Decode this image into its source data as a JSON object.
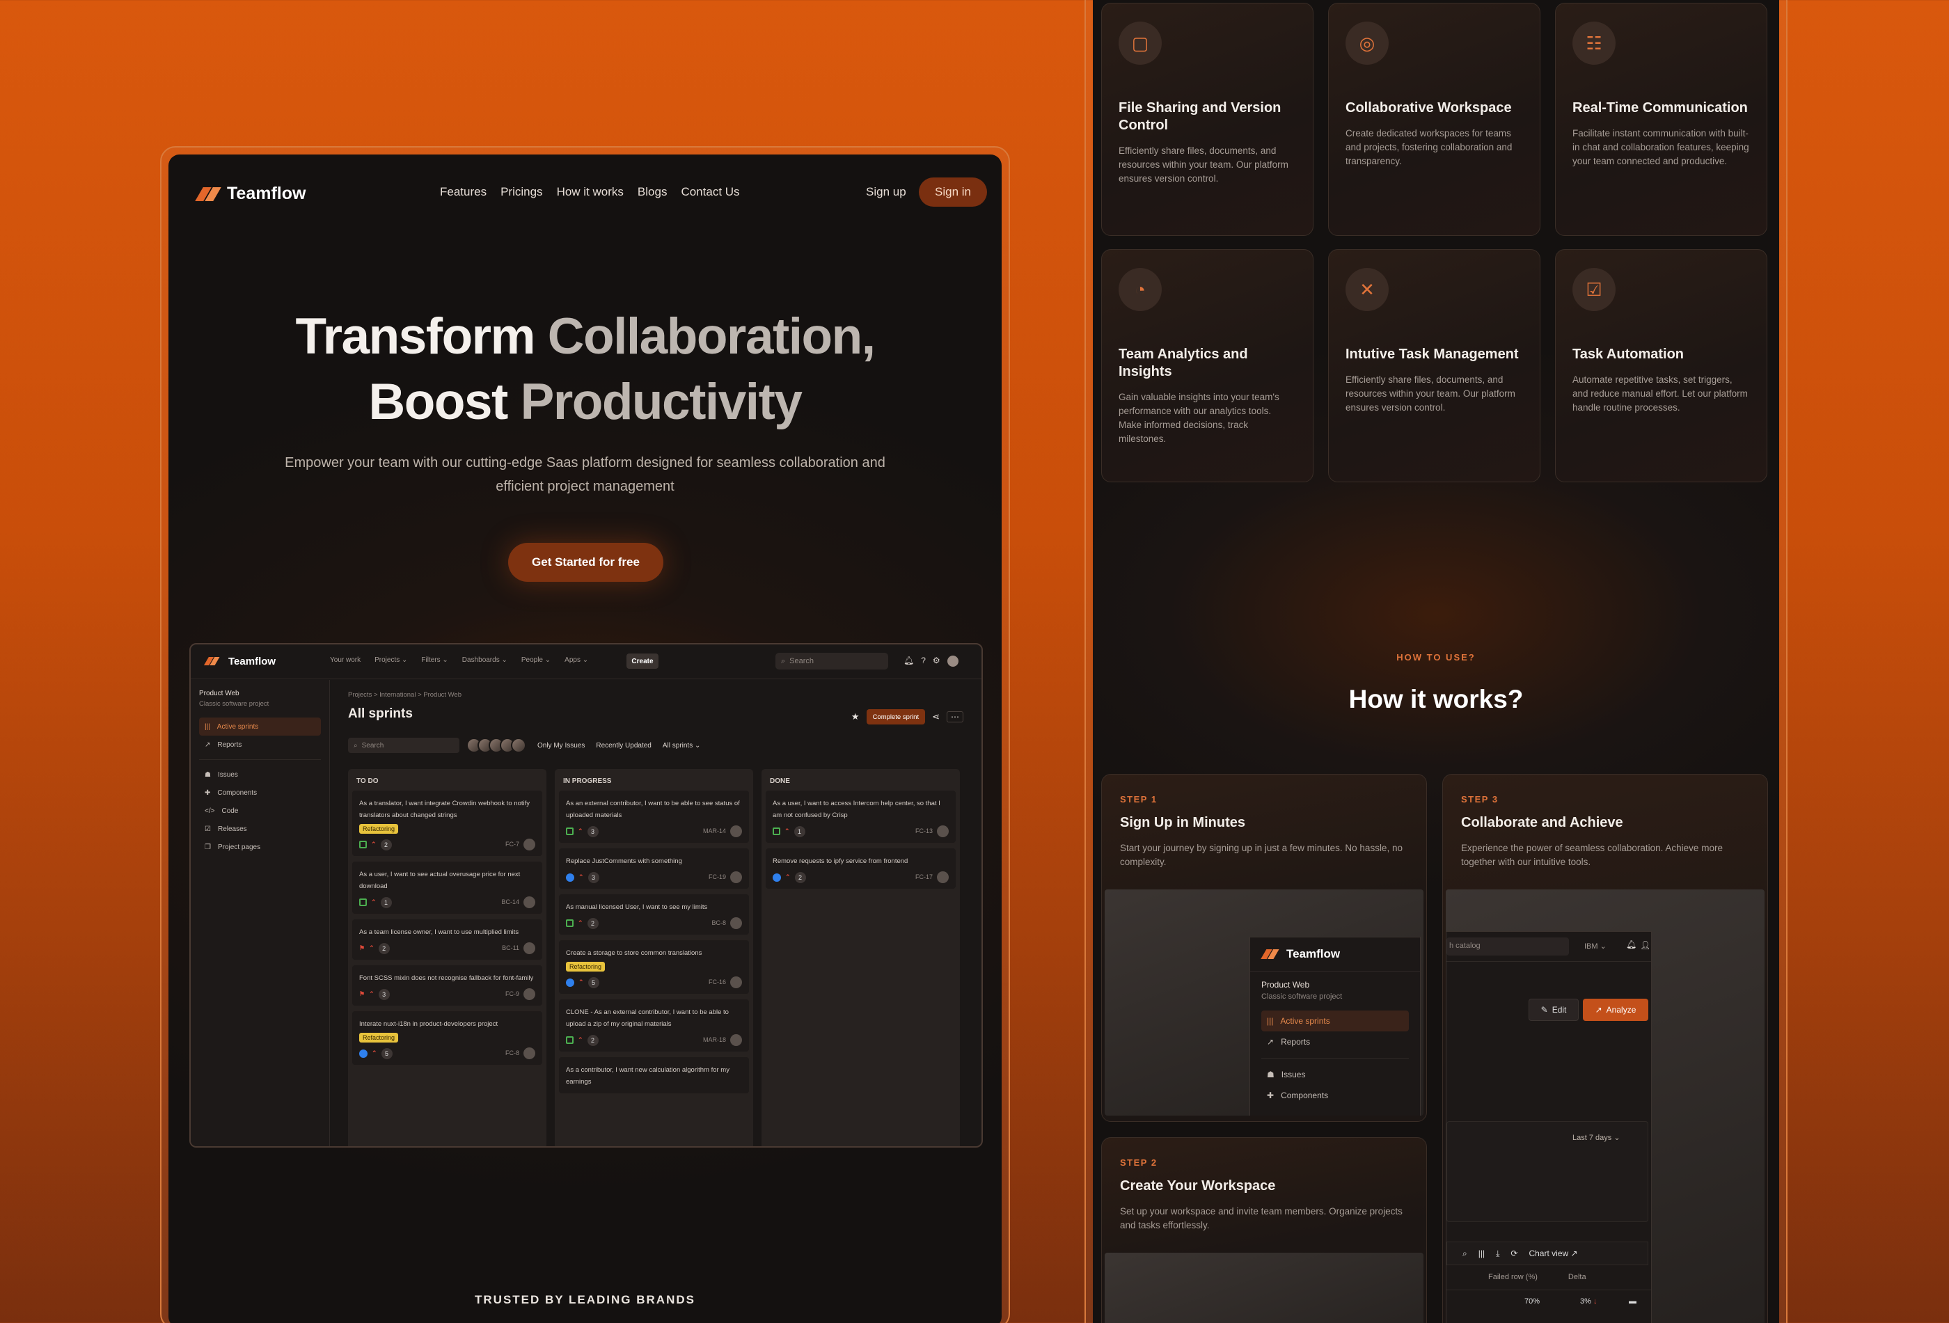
{
  "landing": {
    "brand": "Teamflow",
    "nav": [
      "Features",
      "Pricings",
      "How it works",
      "Blogs",
      "Contact Us"
    ],
    "signup": "Sign up",
    "signin": "Sign in",
    "hero_line1_a": "Transform",
    "hero_line1_b": "Collaboration,",
    "hero_line2_a": "Boost",
    "hero_line2_b": "Productivity",
    "hero_sub": "Empower your team with our cutting-edge Saas platform designed for seamless collaboration and efficient project management",
    "cta": "Get Started for free",
    "trusted": "TRUSTED BY LEADING BRANDS"
  },
  "app": {
    "brand": "Teamflow",
    "menu": [
      "Your work",
      "Projects ⌄",
      "Filters ⌄",
      "Dashboards ⌄",
      "People ⌄",
      "Apps ⌄"
    ],
    "create": "Create",
    "search": "Search",
    "project_name": "Product Web",
    "project_type": "Classic software project",
    "side_items": [
      {
        "label": "Active sprints",
        "active": true
      },
      {
        "label": "Reports"
      },
      {
        "label": "Issues"
      },
      {
        "label": "Components"
      },
      {
        "label": "Code"
      },
      {
        "label": "Releases"
      },
      {
        "label": "Project pages"
      }
    ],
    "crumb": "Projects  >  International  >  Product Web",
    "title": "All sprints",
    "complete": "Complete sprint",
    "board_search": "Search",
    "filters": [
      "Only My Issues",
      "Recently Updated",
      "All sprints ⌄"
    ],
    "columns": [
      {
        "name": "TO DO",
        "cards": [
          {
            "text": "As a translator, I want integrate Crowdin webhook to notify translators about changed strings",
            "tag": "Refactoring",
            "count": "2",
            "id": "FC-7",
            "icon": "square"
          },
          {
            "text": "As a user, I want to see actual overusage price for next download",
            "count": "1",
            "id": "BC-14",
            "icon": "square"
          },
          {
            "text": "As a team license owner, I want to use multiplied limits",
            "count": "2",
            "id": "BC-11",
            "icon": "flag"
          },
          {
            "text": "Font SCSS mixin does not recognise fallback for font-family",
            "count": "3",
            "id": "FC-9",
            "icon": "flag"
          },
          {
            "text": "Interate nuxt-i18n in product-developers project",
            "tag": "Refactoring",
            "count": "5",
            "id": "FC-8",
            "icon": "blue"
          }
        ]
      },
      {
        "name": "IN PROGRESS",
        "cards": [
          {
            "text": "As an external contributor, I want to be able to see status of uploaded materials",
            "count": "3",
            "id": "MAR-14",
            "icon": "square"
          },
          {
            "text": "Replace JustComments with something",
            "count": "3",
            "id": "FC-19",
            "icon": "blue"
          },
          {
            "text": "As manual licensed User, I want to see my limits",
            "count": "2",
            "id": "BC-8",
            "icon": "square"
          },
          {
            "text": "Create a storage to store common translations",
            "tag": "Refactoring",
            "count": "5",
            "id": "FC-16",
            "icon": "blue"
          },
          {
            "text": "CLONE - As an external contributor, I want to be able to upload a zip of my original materials",
            "count": "2",
            "id": "MAR-18",
            "icon": "square"
          },
          {
            "text": "As a contributor, I want new calculation algorithm for my earnings",
            "count": "",
            "id": "",
            "icon": ""
          }
        ]
      },
      {
        "name": "DONE",
        "cards": [
          {
            "text": "As a user, I want to access Intercom help center, so that I am not confused by Crisp",
            "count": "1",
            "id": "FC-13",
            "icon": "square"
          },
          {
            "text": "Remove requests to ipfy service from frontend",
            "count": "2",
            "id": "FC-17",
            "icon": "blue"
          }
        ]
      }
    ]
  },
  "features": [
    {
      "icon": "file-icon",
      "glyph": "▢",
      "title": "File Sharing and Version Control",
      "desc": "Efficiently share files, documents, and resources within your team. Our platform ensures version control."
    },
    {
      "icon": "globe-icon",
      "glyph": "◎",
      "title": "Collaborative Workspace",
      "desc": "Create dedicated workspaces for teams and projects, fostering collaboration and transparency."
    },
    {
      "icon": "chat-icon",
      "glyph": "☷",
      "title": "Real-Time Communication",
      "desc": "Facilitate instant communication with built-in chat and collaboration features, keeping your team connected and productive."
    },
    {
      "icon": "pie-chart-icon",
      "glyph": "◔",
      "title": "Team Analytics and Insights",
      "desc": "Gain valuable insights into your team's performance with our analytics tools. Make informed decisions, track milestones."
    },
    {
      "icon": "tools-icon",
      "glyph": "✕",
      "title": "Intutive Task Management",
      "desc": "Efficiently share files, documents, and resources within your team. Our platform ensures version control."
    },
    {
      "icon": "checkbox-icon",
      "glyph": "☑",
      "title": "Task Automation",
      "desc": "Automate repetitive tasks, set triggers, and reduce manual effort. Let our platform handle routine processes."
    }
  ],
  "how": {
    "eyebrow": "HOW TO USE?",
    "title": "How it works?",
    "steps": [
      {
        "eyebrow": "STEP 1",
        "title": "Sign Up in Minutes",
        "desc": "Start your journey by signing up in just a few minutes. No hassle, no complexity."
      },
      {
        "eyebrow": "STEP 3",
        "title": "Collaborate and Achieve",
        "desc": "Experience the power of seamless collaboration. Achieve more together with our intuitive tools."
      },
      {
        "eyebrow": "STEP 2",
        "title": "Create Your Workspace",
        "desc": "Set up your workspace and invite team members. Organize projects and tasks effortlessly."
      }
    ],
    "mini_brand": "Teamflow",
    "mini_project": "Product Web",
    "mini_type": "Classic software project",
    "mini_items": [
      "Active sprints",
      "Reports",
      "Issues",
      "Components"
    ],
    "s3_search": "h catalog",
    "s3_ibm": "IBM ⌄",
    "s3_edit": "Edit",
    "s3_analyze": "Analyze",
    "s3_range": "Last 7 days ⌄",
    "s3_chartview": "Chart view",
    "s3_col1": "Failed row (%)",
    "s3_col2": "Delta",
    "s3_v1": "70%",
    "s3_v2": "3%"
  },
  "colors": {
    "accent": "#e0733a",
    "brand": "#7e3210",
    "bg": "#d9580d"
  }
}
